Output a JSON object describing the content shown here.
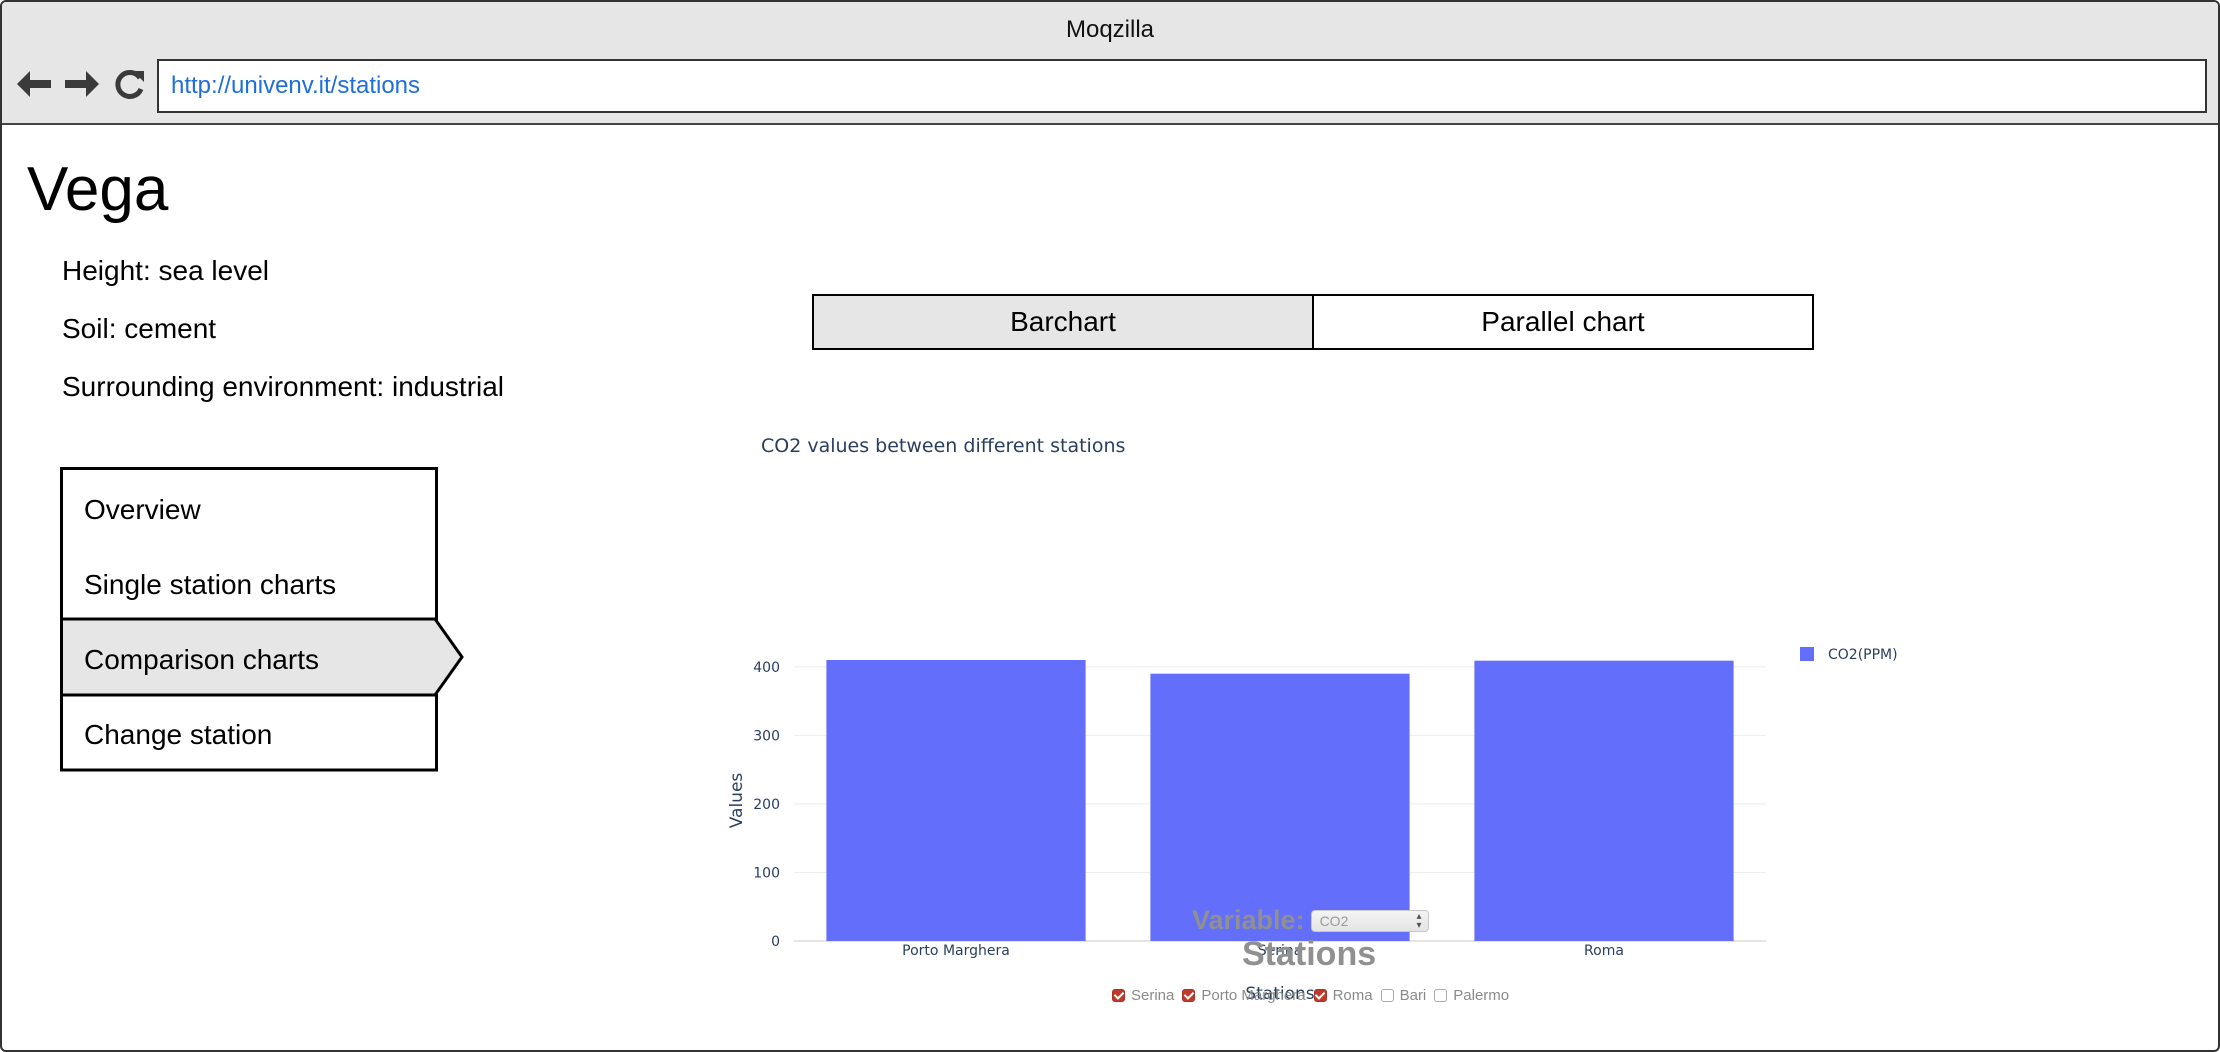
{
  "browser": {
    "title": "Moqzilla",
    "url": "http://univenv.it/stations"
  },
  "station": {
    "name": "Vega",
    "height": "Height: sea level",
    "soil": "Soil: cement",
    "environment": "Surrounding environment: industrial"
  },
  "menu": {
    "items": [
      {
        "label": "Overview"
      },
      {
        "label": "Single station charts"
      },
      {
        "label": "Comparison charts",
        "active": true
      },
      {
        "label": "Change station"
      }
    ]
  },
  "chart_tabs": {
    "barchart": "Barchart",
    "parallel": "Parallel chart",
    "active": "barchart"
  },
  "chart_data": {
    "type": "bar",
    "title": "CO2 values between different stations",
    "xlabel": "Stations",
    "ylabel": "Values",
    "categories": [
      "Porto Marghera",
      "Serina",
      "Roma"
    ],
    "series": [
      {
        "name": "CO2(PPM)",
        "values": [
          410,
          390,
          409
        ],
        "color": "#636efa"
      }
    ],
    "ylim": [
      0,
      400
    ],
    "yticks": [
      0,
      100,
      200,
      300,
      400
    ],
    "legend": "top-right",
    "grid": true
  },
  "controls": {
    "variable_label": "Variable:",
    "variable_value": "CO2",
    "stations_heading": "Stations",
    "stations": [
      {
        "label": "Serina",
        "checked": true
      },
      {
        "label": "Porto Marghera",
        "checked": true
      },
      {
        "label": "Roma",
        "checked": true
      },
      {
        "label": "Bari",
        "checked": false
      },
      {
        "label": "Palermo",
        "checked": false
      }
    ]
  }
}
